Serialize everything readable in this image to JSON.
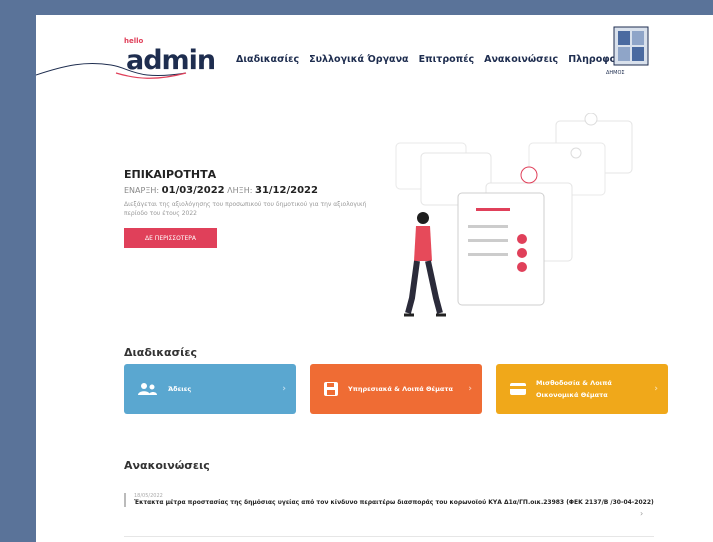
{
  "header": {
    "logo_small": "hello",
    "logo": "admin",
    "nav": [
      "Διαδικασίες",
      "Συλλογικά Όργανα",
      "Επιτροπές",
      "Ανακοινώσεις",
      "Πληροφορίες"
    ],
    "crest_label": "ΔΗΜΟΣ"
  },
  "hero": {
    "title": "ΕΠΙΚΑΙΡΟΤΗΤΑ",
    "start_label": "ΕΝΑΡΞΗ:",
    "start_date": "01/03/2022",
    "end_label": "ΛΗΞΗ:",
    "end_date": "31/12/2022",
    "description": "Διεξάγεται της αξιολόγησης του προσωπικού του δημοτικού για την αξιολογική περίοδο του έτους 2022",
    "button": "ΔΕ ΠΕΡΙΣΣΟΤΕΡΑ"
  },
  "procedures": {
    "title": "Διαδικασίες",
    "cards": [
      {
        "label": "Άδειες",
        "icon": "users-icon",
        "color": "#5aa7d0"
      },
      {
        "label": "Υπηρεσιακά & Λοιπά Θέματα",
        "icon": "floppy-icon",
        "color": "#ef6c34"
      },
      {
        "label": "Μισθοδοσία & Λοιπά Οικονομικά Θέματα",
        "icon": "card-icon",
        "color": "#f0a81a"
      }
    ]
  },
  "announcements": {
    "title": "Ανακοινώσεις",
    "items": [
      {
        "date": "18/05/2022",
        "text": "Έκτακτα μέτρα προστασίας της δημόσιας υγείας από τον κίνδυνο περαιτέρω διασποράς του κορωνοϊού ΚΥΑ Δ1α/ΓΠ.οικ.23983 (ΦΕΚ 2137/Β /30-04-2022)"
      }
    ]
  }
}
